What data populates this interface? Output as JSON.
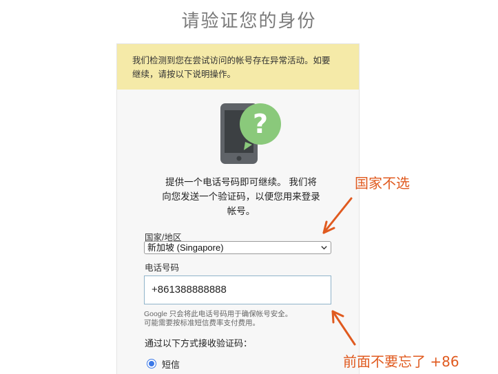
{
  "page": {
    "title": "请验证您的身份"
  },
  "warning": {
    "text_line1": "我们检测到您在尝试访问的帐号存在异常活动。如要",
    "text_line2": "继续，请按以下说明操作。"
  },
  "intro": {
    "line1": "提供一个电话号码即可继续。 我们将",
    "line2": "向您发送一个验证码，以便您用来登录",
    "line3": "帐号。"
  },
  "form": {
    "country_label": "国家/地区",
    "country_value": "新加坡 (Singapore)",
    "phone_label": "电话号码",
    "phone_value": "+861388888888",
    "hint_line1": "Google 只会将此电话号码用于确保帐号安全。",
    "hint_line2": "可能需要按标准短信费率支付费用。",
    "method_heading": "通过以下方式接收验证码：",
    "method_option": "短信"
  },
  "annotations": {
    "country_note": "国家不选",
    "phone_note": "前面不要忘了 +86",
    "color": "#e05a1f"
  },
  "icons": {
    "illustration": "phone-question-icon",
    "select": "chevron-down-icon"
  }
}
